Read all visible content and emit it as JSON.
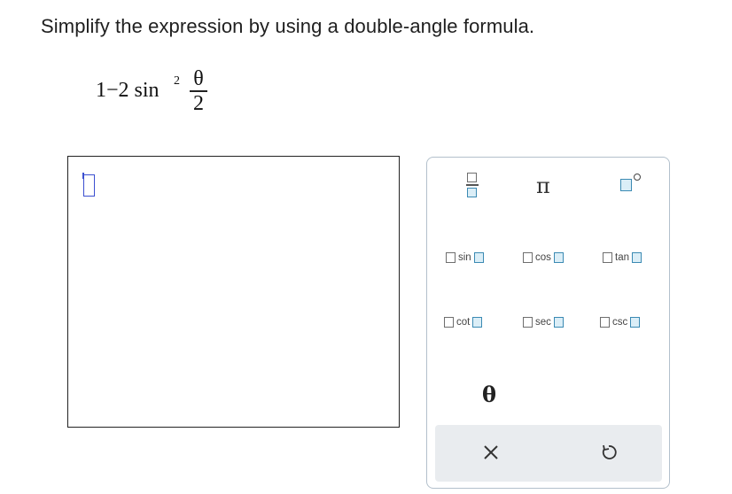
{
  "question": {
    "instruction": "Simplify the expression by using a double-angle formula.",
    "expression": {
      "lead": "1−2 sin",
      "exponent": "2",
      "numerator": "θ",
      "denominator": "2"
    }
  },
  "answer": {
    "value": ""
  },
  "palette": {
    "fraction_key": "fraction-template",
    "pi_key": "π",
    "degree_key": "degree-template",
    "trig_keys": [
      "sin",
      "cos",
      "tan",
      "cot",
      "sec",
      "csc"
    ],
    "theta_key": "θ",
    "clear_key": "×",
    "undo_key": "↺"
  },
  "colors": {
    "accent": "#3b4fd0",
    "key_blue": "#3b8ab3",
    "palette_border": "#b3c0cc",
    "bar_bg": "#e9ecef"
  }
}
